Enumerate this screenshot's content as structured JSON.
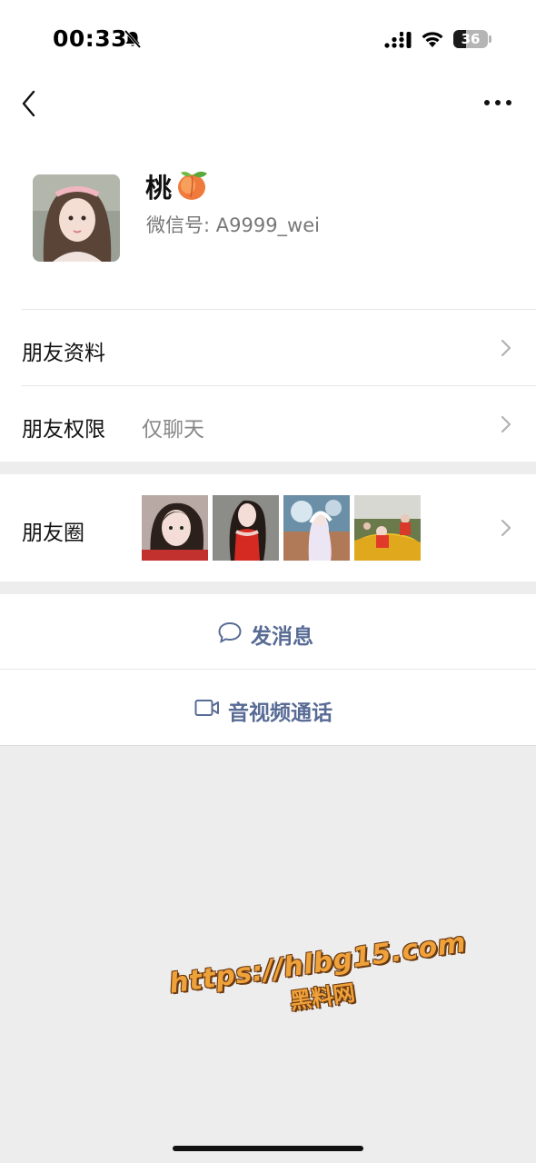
{
  "status_bar": {
    "time": "00:33",
    "battery_level": "36",
    "icons": [
      "bell-muted-icon",
      "signal-icon",
      "wifi-icon",
      "battery-icon"
    ]
  },
  "nav": {
    "icons": [
      "back-icon",
      "more-icon"
    ]
  },
  "profile": {
    "nickname": "桃",
    "nickname_emoji_icon": "peach-icon",
    "wechat_id": "微信号: A9999_wei"
  },
  "rows": {
    "friend_info": {
      "label": "朋友资料"
    },
    "friend_permission": {
      "label": "朋友权限",
      "value": "仅聊天"
    },
    "moments": {
      "label": "朋友圈",
      "thumbnail_count": 4
    }
  },
  "actions": {
    "send_message": "发消息",
    "video_call": "音视频通话"
  },
  "watermark": {
    "url": "https://hlbg15.com",
    "name": "黑料网"
  },
  "colors": {
    "accent_link": "#586b95",
    "page_bg": "#ededed",
    "watermark": "#f0a23a"
  }
}
